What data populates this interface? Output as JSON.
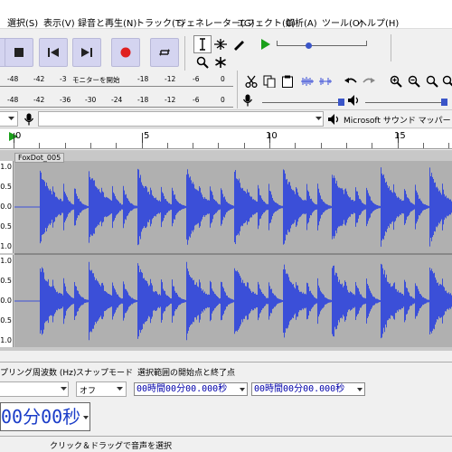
{
  "menu": {
    "items": [
      "選択(S)",
      "表示(V)",
      "録音と再生(N)",
      "トラック(T)",
      "ジェネレーター(G)",
      "エフェクト(C)",
      "解析(A)",
      "ツール(O)",
      "ヘルプ(H)"
    ]
  },
  "meters": {
    "record_ticks": [
      "-48",
      "-42",
      "-3",
      "モニターを開始",
      "-18",
      "-12",
      "-6",
      "0"
    ],
    "play_ticks": [
      "-48",
      "-42",
      "-36",
      "-30",
      "-24",
      "-18",
      "-12",
      "-6",
      "0"
    ]
  },
  "device": {
    "output_device": "Microsoft サウンド マッパー - Out"
  },
  "timeline": {
    "labels": [
      "0",
      "5",
      "10",
      "15"
    ]
  },
  "track": {
    "name": "FoxDot_005",
    "ruler_top": [
      "1.0",
      "0.5",
      "0.0",
      "-0.5",
      "-1.0"
    ],
    "ruler_bottom": [
      "1.0",
      "0.5",
      "0.0",
      "-0.5",
      "-1.0"
    ],
    "wave_color": "#3b4fd8"
  },
  "selection": {
    "rate_label": "プリング周波数 (Hz)",
    "snap_label": "スナップモード",
    "range_label": "選択範囲の開始点と終了点",
    "snap_value": "オフ",
    "start_time": "00時間00分00.000秒",
    "end_time": "00時間00分00.000秒"
  },
  "audio_position": "00分00秒",
  "status": "クリック＆ドラッグで音声を選択"
}
